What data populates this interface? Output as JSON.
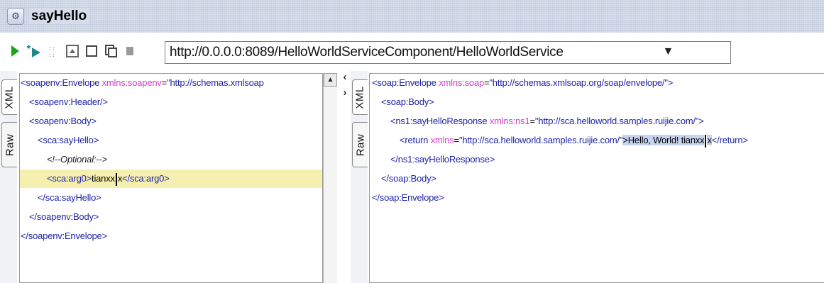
{
  "window": {
    "title": "sayHello",
    "icon": "soap-document-icon"
  },
  "toolbar": {
    "buttons": [
      {
        "name": "run-icon",
        "color": "#1aa31a"
      },
      {
        "name": "add-endpoint-icon",
        "color": "#1c8a8a"
      },
      {
        "name": "tidy-icon",
        "color": "#777777"
      },
      {
        "name": "split-vertical-icon",
        "color": "#777777"
      },
      {
        "name": "split-horizontal-icon",
        "color": "#777777"
      },
      {
        "name": "copy-icon",
        "color": "#777777"
      },
      {
        "name": "stop-icon",
        "color": "#999999"
      }
    ],
    "endpoint": "http://0.0.0.0:8089/HelloWorldServiceComponent/HelloWorldService"
  },
  "request": {
    "tabs": {
      "xml": "XML",
      "raw": "Raw"
    },
    "lines": {
      "l1": {
        "tag_open": "<soapenv:Envelope ",
        "attr": "xmlns:soapenv",
        "eq": "=",
        "val": "\"http://schemas.xmlsoap"
      },
      "l2": {
        "text": "<soapenv:Header/>"
      },
      "l3": {
        "text": "<soapenv:Body>"
      },
      "l4": {
        "text": "<sca:sayHello>"
      },
      "l5": {
        "text": "<!--Optional:-->"
      },
      "l6": {
        "open": "<sca:arg0>",
        "value_a": "tianxx",
        "value_b": "x",
        "close": "</sca:arg0>"
      },
      "l7": {
        "text": "</sca:sayHello>"
      },
      "l8": {
        "text": "</soapenv:Body>"
      },
      "l9": {
        "text": "</soapenv:Envelope>"
      }
    }
  },
  "response": {
    "tabs": {
      "xml": "XML",
      "raw": "Raw"
    },
    "lines": {
      "l1": {
        "tag_open": "<soap:Envelope ",
        "attr": "xmlns:soap",
        "eq": "=",
        "val": "\"http://schemas.xmlsoap.org/soap/envelope/\">"
      },
      "l2": {
        "text": "<soap:Body>"
      },
      "l3": {
        "tag_open": "<ns1:sayHelloResponse ",
        "attr": "xmlns:ns1",
        "eq": "=",
        "val": "\"http://sca.helloworld.samples.ruijie.com/\">"
      },
      "l4": {
        "tag_open": "<return ",
        "attr": "xmlns",
        "eq": "=",
        "val": "\"http://sca.helloworld.samples.ruijie.com/\"",
        "sel_a": ">Hello, World! tianxx",
        "sel_b": "x",
        "close": "</return>"
      },
      "l5": {
        "text": "</ns1:sayHelloResponse>"
      },
      "l6": {
        "text": "</soap:Body>"
      },
      "l7": {
        "text": "</soap:Envelope>"
      }
    }
  }
}
